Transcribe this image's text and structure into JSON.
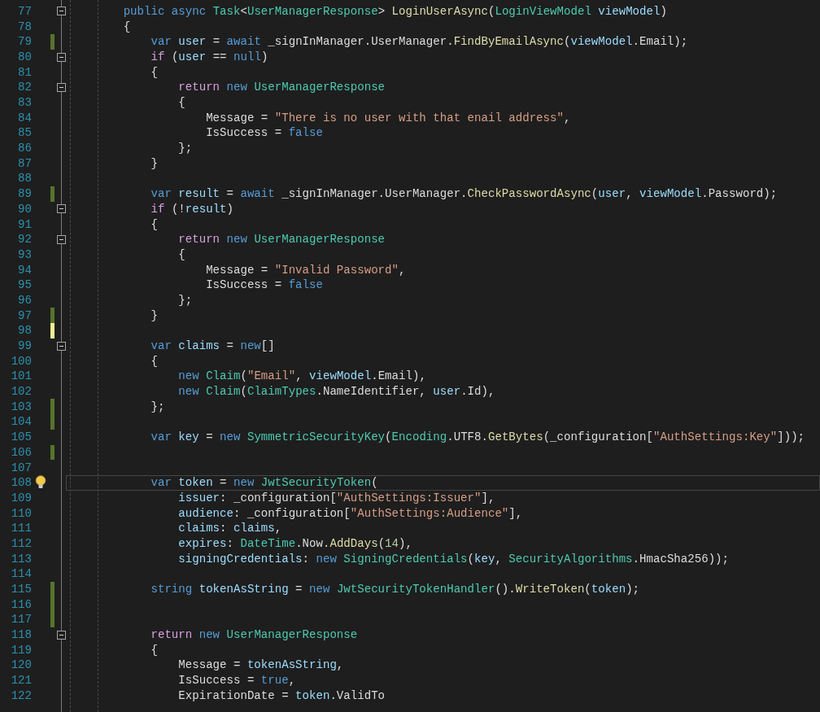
{
  "editor": {
    "lines": [
      {
        "number": "77",
        "fold": true,
        "current": false,
        "tokens": [
          {
            "kind": "keyword",
            "text": "        public async "
          },
          {
            "kind": "type",
            "text": "Task"
          },
          {
            "kind": "plain",
            "text": "<"
          },
          {
            "kind": "type",
            "text": "UserManagerResponse"
          },
          {
            "kind": "plain",
            "text": "> "
          },
          {
            "kind": "method",
            "text": "LoginUserAsync"
          },
          {
            "kind": "plain",
            "text": "("
          },
          {
            "kind": "type",
            "text": "LoginViewModel"
          },
          {
            "kind": "variable",
            "text": " viewModel"
          },
          {
            "kind": "plain",
            "text": ")"
          }
        ]
      },
      {
        "number": "78",
        "fold": false,
        "current": false,
        "tokens": [
          {
            "kind": "plain",
            "text": "        {"
          }
        ]
      },
      {
        "number": "79",
        "fold": false,
        "current": false,
        "color": "#57742b",
        "tokens": [
          {
            "kind": "keyword",
            "text": "            var "
          },
          {
            "kind": "variable",
            "text": "user"
          },
          {
            "kind": "plain",
            "text": " = "
          },
          {
            "kind": "keyword",
            "text": "await "
          },
          {
            "kind": "plain",
            "text": "_signInManager.UserManager."
          },
          {
            "kind": "method",
            "text": "FindByEmailAsync"
          },
          {
            "kind": "plain",
            "text": "("
          },
          {
            "kind": "variable",
            "text": "viewModel"
          },
          {
            "kind": "plain",
            "text": ".Email);"
          }
        ]
      },
      {
        "number": "80",
        "fold": true,
        "current": false,
        "tokens": [
          {
            "kind": "control",
            "text": "            if "
          },
          {
            "kind": "plain",
            "text": "("
          },
          {
            "kind": "variable",
            "text": "user"
          },
          {
            "kind": "plain",
            "text": " == "
          },
          {
            "kind": "keyword",
            "text": "null"
          },
          {
            "kind": "plain",
            "text": ")"
          }
        ]
      },
      {
        "number": "81",
        "fold": false,
        "current": false,
        "tokens": [
          {
            "kind": "plain",
            "text": "            {"
          }
        ]
      },
      {
        "number": "82",
        "fold": true,
        "current": false,
        "tokens": [
          {
            "kind": "control",
            "text": "                return "
          },
          {
            "kind": "keyword",
            "text": "new "
          },
          {
            "kind": "type",
            "text": "UserManagerResponse"
          }
        ]
      },
      {
        "number": "83",
        "fold": false,
        "current": false,
        "tokens": [
          {
            "kind": "plain",
            "text": "                {"
          }
        ]
      },
      {
        "number": "84",
        "fold": false,
        "current": false,
        "tokens": [
          {
            "kind": "plain",
            "text": "                    Message = "
          },
          {
            "kind": "string",
            "text": "\"There is no user with that enail address\""
          },
          {
            "kind": "plain",
            "text": ","
          }
        ]
      },
      {
        "number": "85",
        "fold": false,
        "current": false,
        "tokens": [
          {
            "kind": "plain",
            "text": "                    IsSuccess = "
          },
          {
            "kind": "keyword",
            "text": "false"
          }
        ]
      },
      {
        "number": "86",
        "fold": false,
        "current": false,
        "tokens": [
          {
            "kind": "plain",
            "text": "                };"
          }
        ]
      },
      {
        "number": "87",
        "fold": false,
        "current": false,
        "tokens": [
          {
            "kind": "plain",
            "text": "            }"
          }
        ]
      },
      {
        "number": "88",
        "fold": false,
        "current": false
      },
      {
        "number": "89",
        "fold": false,
        "current": false,
        "color": "#57742b",
        "tokens": [
          {
            "kind": "keyword",
            "text": "            var "
          },
          {
            "kind": "variable",
            "text": "result"
          },
          {
            "kind": "plain",
            "text": " = "
          },
          {
            "kind": "keyword",
            "text": "await "
          },
          {
            "kind": "plain",
            "text": "_signInManager.UserManager."
          },
          {
            "kind": "method",
            "text": "CheckPasswordAsync"
          },
          {
            "kind": "plain",
            "text": "("
          },
          {
            "kind": "variable",
            "text": "user"
          },
          {
            "kind": "plain",
            "text": ", "
          },
          {
            "kind": "variable",
            "text": "viewModel"
          },
          {
            "kind": "plain",
            "text": ".Password);"
          }
        ]
      },
      {
        "number": "90",
        "fold": true,
        "current": false,
        "tokens": [
          {
            "kind": "control",
            "text": "            if "
          },
          {
            "kind": "plain",
            "text": "(!"
          },
          {
            "kind": "variable",
            "text": "result"
          },
          {
            "kind": "plain",
            "text": ")"
          }
        ]
      },
      {
        "number": "91",
        "fold": false,
        "current": false,
        "tokens": [
          {
            "kind": "plain",
            "text": "            {"
          }
        ]
      },
      {
        "number": "92",
        "fold": true,
        "current": false,
        "tokens": [
          {
            "kind": "control",
            "text": "                return "
          },
          {
            "kind": "keyword",
            "text": "new "
          },
          {
            "kind": "type",
            "text": "UserManagerResponse"
          }
        ]
      },
      {
        "number": "93",
        "fold": false,
        "current": false,
        "tokens": [
          {
            "kind": "plain",
            "text": "                {"
          }
        ]
      },
      {
        "number": "94",
        "fold": false,
        "current": false,
        "tokens": [
          {
            "kind": "plain",
            "text": "                    Message = "
          },
          {
            "kind": "string",
            "text": "\"Invalid Password\""
          },
          {
            "kind": "plain",
            "text": ","
          }
        ]
      },
      {
        "number": "95",
        "fold": false,
        "current": false,
        "tokens": [
          {
            "kind": "plain",
            "text": "                    IsSuccess = "
          },
          {
            "kind": "keyword",
            "text": "false"
          }
        ]
      },
      {
        "number": "96",
        "fold": false,
        "current": false,
        "tokens": [
          {
            "kind": "plain",
            "text": "                };"
          }
        ]
      },
      {
        "number": "97",
        "fold": false,
        "current": false,
        "color": "#57742b",
        "tokens": [
          {
            "kind": "plain",
            "text": "            }"
          }
        ]
      },
      {
        "number": "98",
        "fold": false,
        "current": false,
        "color": "#efef91"
      },
      {
        "number": "99",
        "fold": true,
        "current": false,
        "tokens": [
          {
            "kind": "keyword",
            "text": "            var "
          },
          {
            "kind": "variable",
            "text": "claims"
          },
          {
            "kind": "plain",
            "text": " = "
          },
          {
            "kind": "keyword",
            "text": "new"
          },
          {
            "kind": "plain",
            "text": "[]"
          }
        ]
      },
      {
        "number": "100",
        "fold": false,
        "current": false,
        "tokens": [
          {
            "kind": "plain",
            "text": "            {"
          }
        ]
      },
      {
        "number": "101",
        "fold": false,
        "current": false,
        "tokens": [
          {
            "kind": "keyword",
            "text": "                new "
          },
          {
            "kind": "type",
            "text": "Claim"
          },
          {
            "kind": "plain",
            "text": "("
          },
          {
            "kind": "string",
            "text": "\"Email\""
          },
          {
            "kind": "plain",
            "text": ", "
          },
          {
            "kind": "variable",
            "text": "viewModel"
          },
          {
            "kind": "plain",
            "text": ".Email),"
          }
        ]
      },
      {
        "number": "102",
        "fold": false,
        "current": false,
        "tokens": [
          {
            "kind": "keyword",
            "text": "                new "
          },
          {
            "kind": "type",
            "text": "Claim"
          },
          {
            "kind": "plain",
            "text": "("
          },
          {
            "kind": "type",
            "text": "ClaimTypes"
          },
          {
            "kind": "plain",
            "text": ".NameIdentifier, "
          },
          {
            "kind": "variable",
            "text": "user"
          },
          {
            "kind": "plain",
            "text": ".Id),"
          }
        ]
      },
      {
        "number": "103",
        "fold": false,
        "current": false,
        "color": "#57742b",
        "tokens": [
          {
            "kind": "plain",
            "text": "            };"
          }
        ]
      },
      {
        "number": "104",
        "fold": false,
        "current": false,
        "color": "#57742b"
      },
      {
        "number": "105",
        "fold": false,
        "current": false,
        "tokens": [
          {
            "kind": "keyword",
            "text": "            var "
          },
          {
            "kind": "variable",
            "text": "key"
          },
          {
            "kind": "plain",
            "text": " = "
          },
          {
            "kind": "keyword",
            "text": "new "
          },
          {
            "kind": "type",
            "text": "SymmetricSecurityKey"
          },
          {
            "kind": "plain",
            "text": "("
          },
          {
            "kind": "type",
            "text": "Encoding"
          },
          {
            "kind": "plain",
            "text": ".UTF8."
          },
          {
            "kind": "method",
            "text": "GetBytes"
          },
          {
            "kind": "plain",
            "text": "(_configuration["
          },
          {
            "kind": "string",
            "text": "\"AuthSettings:Key\""
          },
          {
            "kind": "plain",
            "text": "]));"
          }
        ]
      },
      {
        "number": "106",
        "fold": false,
        "current": false,
        "color": "#57742b"
      },
      {
        "number": "107",
        "fold": false,
        "current": false
      },
      {
        "number": "108",
        "fold": false,
        "current": true,
        "lightbulb": true,
        "tokens": [
          {
            "kind": "keyword",
            "text": "            var "
          },
          {
            "kind": "variable",
            "text": "token"
          },
          {
            "kind": "plain",
            "text": " = "
          },
          {
            "kind": "keyword",
            "text": "new "
          },
          {
            "kind": "type",
            "text": "JwtSecurityToken"
          },
          {
            "kind": "plain",
            "text": "("
          }
        ]
      },
      {
        "number": "109",
        "fold": false,
        "current": false,
        "tokens": [
          {
            "kind": "variable",
            "text": "                issuer"
          },
          {
            "kind": "plain",
            "text": ": _configuration["
          },
          {
            "kind": "string",
            "text": "\"AuthSettings:Issuer\""
          },
          {
            "kind": "plain",
            "text": "],"
          }
        ]
      },
      {
        "number": "110",
        "fold": false,
        "current": false,
        "tokens": [
          {
            "kind": "variable",
            "text": "                audience"
          },
          {
            "kind": "plain",
            "text": ": _configuration["
          },
          {
            "kind": "string",
            "text": "\"AuthSettings:Audience\""
          },
          {
            "kind": "plain",
            "text": "],"
          }
        ]
      },
      {
        "number": "111",
        "fold": false,
        "current": false,
        "tokens": [
          {
            "kind": "variable",
            "text": "                claims"
          },
          {
            "kind": "plain",
            "text": ": "
          },
          {
            "kind": "variable",
            "text": "claims"
          },
          {
            "kind": "plain",
            "text": ","
          }
        ]
      },
      {
        "number": "112",
        "fold": false,
        "current": false,
        "tokens": [
          {
            "kind": "variable",
            "text": "                expires"
          },
          {
            "kind": "plain",
            "text": ": "
          },
          {
            "kind": "type",
            "text": "DateTime"
          },
          {
            "kind": "plain",
            "text": ".Now."
          },
          {
            "kind": "method",
            "text": "AddDays"
          },
          {
            "kind": "plain",
            "text": "("
          },
          {
            "kind": "number",
            "text": "14"
          },
          {
            "kind": "plain",
            "text": "),"
          }
        ]
      },
      {
        "number": "113",
        "fold": false,
        "current": false,
        "tokens": [
          {
            "kind": "variable",
            "text": "                signingCredentials"
          },
          {
            "kind": "plain",
            "text": ": "
          },
          {
            "kind": "keyword",
            "text": "new "
          },
          {
            "kind": "type",
            "text": "SigningCredentials"
          },
          {
            "kind": "plain",
            "text": "("
          },
          {
            "kind": "variable",
            "text": "key"
          },
          {
            "kind": "plain",
            "text": ", "
          },
          {
            "kind": "type",
            "text": "SecurityAlgorithms"
          },
          {
            "kind": "plain",
            "text": ".HmacSha256));"
          }
        ]
      },
      {
        "number": "114",
        "fold": false,
        "current": false
      },
      {
        "number": "115",
        "fold": false,
        "current": false,
        "color": "#57742b",
        "tokens": [
          {
            "kind": "keyword",
            "text": "            string "
          },
          {
            "kind": "variable",
            "text": "tokenAsString"
          },
          {
            "kind": "plain",
            "text": " = "
          },
          {
            "kind": "keyword",
            "text": "new "
          },
          {
            "kind": "type",
            "text": "JwtSecurityTokenHandler"
          },
          {
            "kind": "plain",
            "text": "()."
          },
          {
            "kind": "method",
            "text": "WriteToken"
          },
          {
            "kind": "plain",
            "text": "("
          },
          {
            "kind": "variable",
            "text": "token"
          },
          {
            "kind": "plain",
            "text": ");"
          }
        ]
      },
      {
        "number": "116",
        "fold": false,
        "current": false,
        "color": "#57742b"
      },
      {
        "number": "117",
        "fold": false,
        "current": false,
        "color": "#57742b"
      },
      {
        "number": "118",
        "fold": true,
        "current": false,
        "tokens": [
          {
            "kind": "control",
            "text": "            return "
          },
          {
            "kind": "keyword",
            "text": "new "
          },
          {
            "kind": "type",
            "text": "UserManagerResponse"
          }
        ]
      },
      {
        "number": "119",
        "fold": false,
        "current": false,
        "tokens": [
          {
            "kind": "plain",
            "text": "            {"
          }
        ]
      },
      {
        "number": "120",
        "fold": false,
        "current": false,
        "tokens": [
          {
            "kind": "plain",
            "text": "                Message = "
          },
          {
            "kind": "variable",
            "text": "tokenAsString"
          },
          {
            "kind": "plain",
            "text": ","
          }
        ]
      },
      {
        "number": "121",
        "fold": false,
        "current": false,
        "tokens": [
          {
            "kind": "plain",
            "text": "                IsSuccess = "
          },
          {
            "kind": "keyword",
            "text": "true"
          },
          {
            "kind": "plain",
            "text": ","
          }
        ]
      },
      {
        "number": "122",
        "fold": false,
        "current": false,
        "tokens": [
          {
            "kind": "plain",
            "text": "                ExpirationDate = "
          },
          {
            "kind": "variable",
            "text": "token"
          },
          {
            "kind": "plain",
            "text": ".ValidTo"
          }
        ]
      }
    ]
  }
}
